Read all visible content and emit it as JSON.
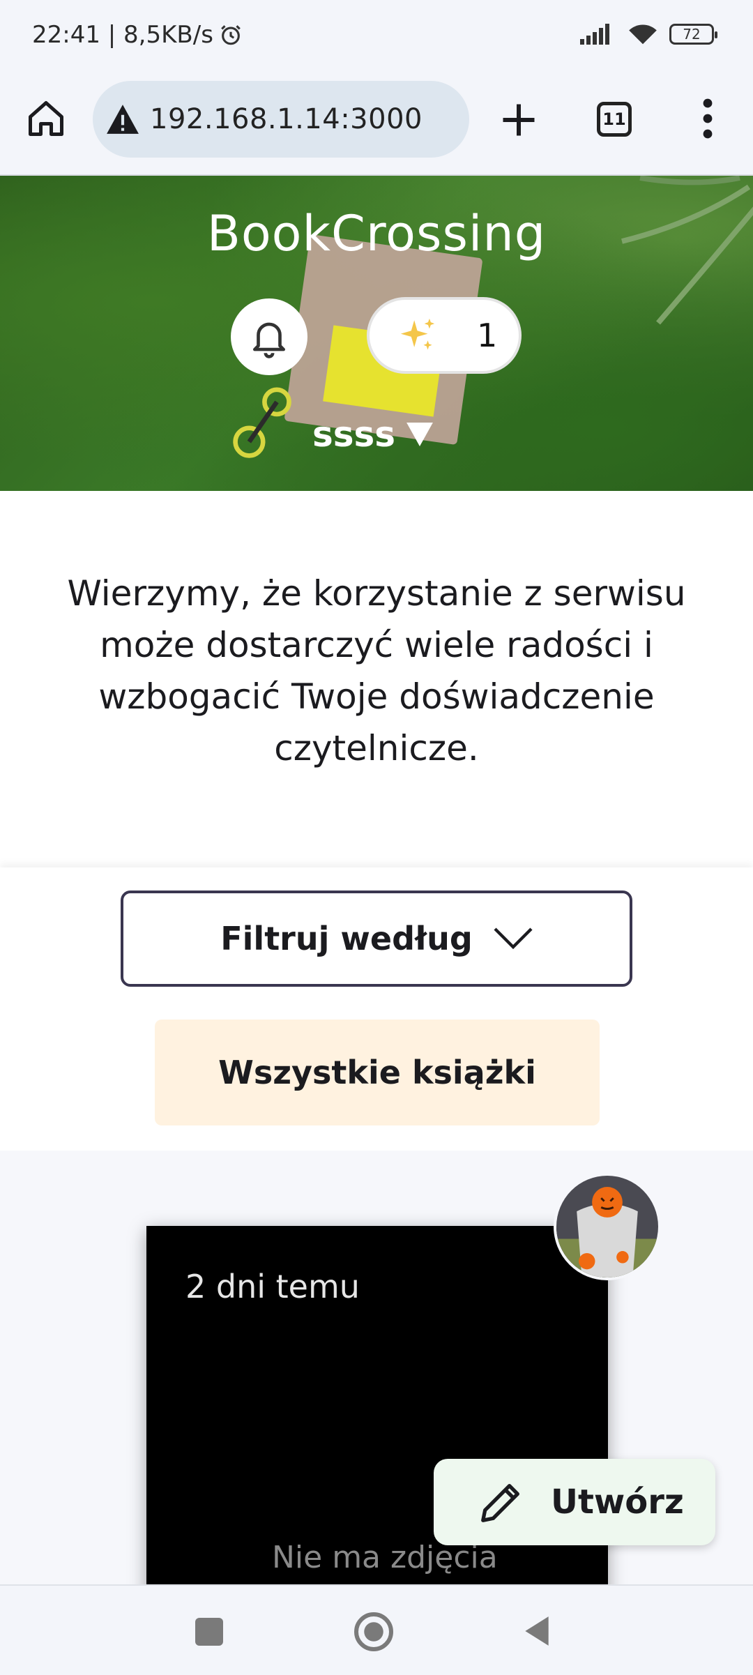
{
  "status_bar": {
    "time_speed": "22:41 | 8,5KB/s",
    "battery": "72"
  },
  "browser": {
    "url": "192.168.1.14:3000",
    "tab_count": "11"
  },
  "hero": {
    "title": "BookCrossing",
    "points_count": "1",
    "username": "ssss"
  },
  "intro": {
    "text": "Wierzymy, że korzystanie z serwisu może dostarczyć wiele radości i wzbogacić Twoje doświadczenie czytelnicze."
  },
  "filters": {
    "filter_label": "Filtruj według",
    "all_books_label": "Wszystkie książki"
  },
  "feed": {
    "card": {
      "time_ago": "2 dni temu",
      "no_image_text": "Nie ma zdjęcia"
    },
    "create_label": "Utwórz"
  },
  "icons": {
    "alarm": "alarm-icon",
    "signal": "signal-icon",
    "wifi": "wifi-icon",
    "home": "home-icon",
    "warning": "warning-icon",
    "plus": "plus-icon",
    "menu": "more-vert-icon",
    "bell": "bell-icon",
    "sparkle": "sparkles-icon",
    "caret": "caret-down-icon",
    "chevron": "chevron-down-icon",
    "pencil": "pencil-icon"
  },
  "colors": {
    "filter_border": "#3a3650",
    "all_books_bg": "#fff2e0",
    "create_bg": "#eef8ef",
    "url_bg": "#dde6ef"
  }
}
